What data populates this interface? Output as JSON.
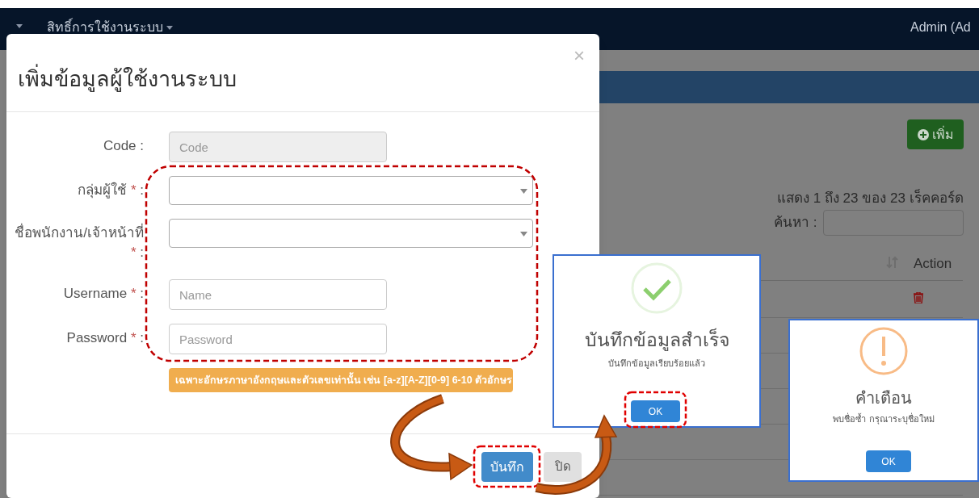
{
  "navbar": {
    "menu": "สิทธิ์การใช้งานระบบ",
    "user": "Admin (Ad"
  },
  "background": {
    "add_button": "เพิ่ม",
    "info": "แสดง 1 ถึง 23 ของ 23 เร็คคอร์ด",
    "search_label": "ค้นหา :",
    "columns": [
      "Action"
    ]
  },
  "modal": {
    "title": "เพิ่มข้อมูลผู้ใช้งานระบบ",
    "close": "×",
    "required_mark": "*",
    "fields": [
      {
        "label": "Code",
        "suffix": ":",
        "kind": "input",
        "placeholder": "Code",
        "required": false,
        "disabled": true
      },
      {
        "label": "กลุ่มผู้ใช้",
        "suffix": ":",
        "kind": "select",
        "required": true
      },
      {
        "label": "ชื่อพนักงาน/เจ้าหน้าที่",
        "suffix": ":",
        "kind": "select",
        "required": true
      },
      {
        "label": "Username",
        "suffix": ":",
        "kind": "input",
        "placeholder": "Name",
        "required": true,
        "disabled": false
      },
      {
        "label": "Password",
        "suffix": ":",
        "kind": "input",
        "placeholder": "Password",
        "required": true,
        "disabled": false
      }
    ],
    "hint": "เฉพาะอักษรภาษาอังกฤษและตัวเลขเท่านั้น เช่น [a-z][A-Z][0-9] 6-10 ตัวอักษร",
    "save_button": "บันทึก",
    "close_button": "ปิด"
  },
  "dialogs": [
    {
      "kind": "success",
      "title": "บันทึกข้อมูลสำเร็จ",
      "message": "บันทึกข้อมูลเรียบร้อยแล้ว",
      "button": "OK"
    },
    {
      "kind": "warning",
      "title": "คำเตือน",
      "message": "พบชื่อซ้ำ กรุณาระบุชื่อใหม่",
      "button": "OK"
    }
  ]
}
